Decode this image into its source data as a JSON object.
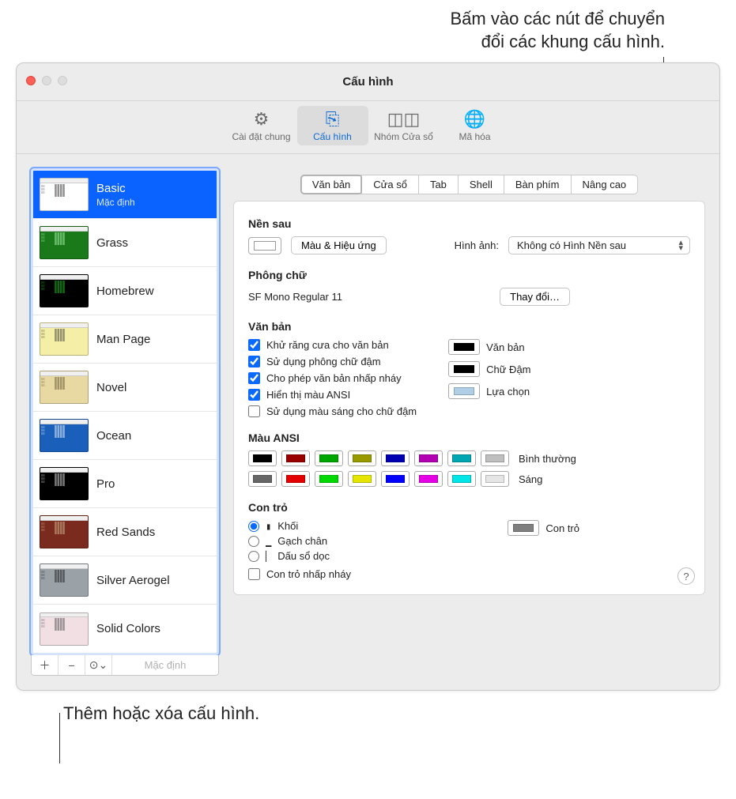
{
  "annotations": {
    "top": "Bấm vào các nút để chuyển\nđổi các khung cấu hình.",
    "bottom": "Thêm hoặc xóa cấu hình."
  },
  "window_title": "Cấu hình",
  "toolbar": [
    {
      "label": "Cài đặt chung",
      "icon": "⚙︎"
    },
    {
      "label": "Cấu hình",
      "icon": "⎘",
      "active": true
    },
    {
      "label": "Nhóm Cửa sổ",
      "icon": "◫◫"
    },
    {
      "label": "Mã hóa",
      "icon": "🌐"
    }
  ],
  "profiles": [
    {
      "name": "Basic",
      "sub": "Mặc định",
      "bg": "#ffffff",
      "fg": "#222",
      "selected": true
    },
    {
      "name": "Grass",
      "bg": "#1a7a1a",
      "fg": "#b6ffb6"
    },
    {
      "name": "Homebrew",
      "bg": "#000000",
      "fg": "#23d423"
    },
    {
      "name": "Man Page",
      "bg": "#f4eea6",
      "fg": "#333"
    },
    {
      "name": "Novel",
      "bg": "#e8d9a3",
      "fg": "#5a4a2d"
    },
    {
      "name": "Ocean",
      "bg": "#1a5fba",
      "fg": "#ffffff"
    },
    {
      "name": "Pro",
      "bg": "#000000",
      "fg": "#f1f1f1"
    },
    {
      "name": "Red Sands",
      "bg": "#7b2a1e",
      "fg": "#d8c69a"
    },
    {
      "name": "Silver Aerogel",
      "bg": "#9aa1a7",
      "fg": "#111"
    },
    {
      "name": "Solid Colors",
      "bg": "#f1dfe4",
      "fg": "#444"
    }
  ],
  "sidebar_footer": {
    "default": "Mặc định"
  },
  "tabs": [
    "Văn bản",
    "Cửa sổ",
    "Tab",
    "Shell",
    "Bàn phím",
    "Nâng cao"
  ],
  "active_tab": 0,
  "background": {
    "title": "Nền sau",
    "effects_btn": "Màu & Hiệu ứng",
    "image_label": "Hình ảnh:",
    "image_value": "Không có Hình Nền sau"
  },
  "font": {
    "title": "Phông chữ",
    "value": "SF Mono Regular 11",
    "change_btn": "Thay đổi…"
  },
  "text": {
    "title": "Văn bản",
    "checks": [
      "Khử răng cưa cho văn bản",
      "Sử dụng phông chữ đậm",
      "Cho phép văn bản nhấp nháy",
      "Hiển thị màu ANSI",
      "Sử dụng màu sáng cho chữ đậm"
    ],
    "checks_state": [
      true,
      true,
      true,
      true,
      false
    ],
    "wells": [
      {
        "label": "Văn bản",
        "color": "#000000"
      },
      {
        "label": "Chữ Đậm",
        "color": "#000000"
      },
      {
        "label": "Lựa chọn",
        "color": "#b0cfe6"
      }
    ]
  },
  "ansi": {
    "title": "Màu ANSI",
    "normal_label": "Bình thường",
    "bright_label": "Sáng",
    "normal": [
      "#000000",
      "#990000",
      "#00a600",
      "#999900",
      "#0000b2",
      "#b200b2",
      "#00a6b2",
      "#bfbfbf"
    ],
    "bright": [
      "#666666",
      "#e50000",
      "#00d900",
      "#e5e500",
      "#0000ff",
      "#e500e5",
      "#00e5e5",
      "#e5e5e5"
    ]
  },
  "cursor": {
    "title": "Con trỏ",
    "radios": [
      "Khối",
      "Gạch chân",
      "Dấu sổ dọc"
    ],
    "glyphs": [
      "▮",
      "▁",
      "▏"
    ],
    "selected": 0,
    "blink": "Con trỏ nhấp nháy",
    "well_label": "Con trỏ",
    "well_color": "#7f7f7f"
  }
}
